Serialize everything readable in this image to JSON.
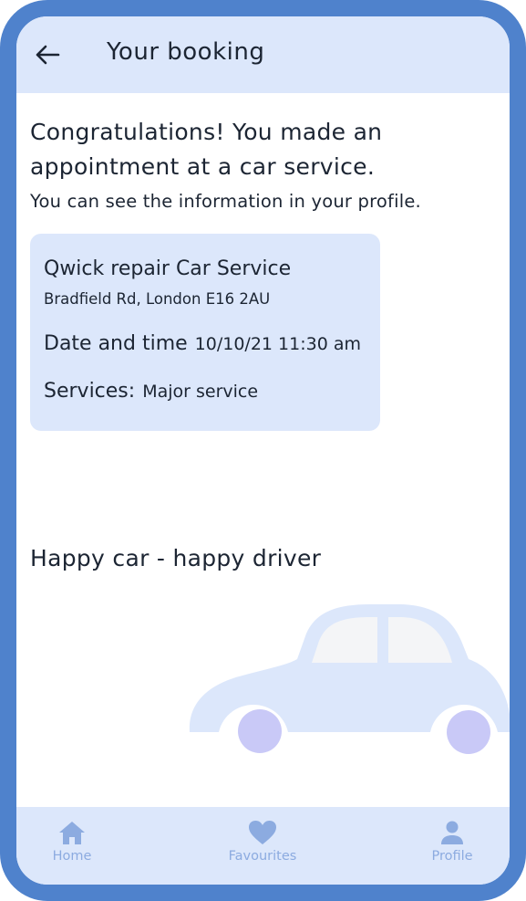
{
  "header": {
    "title": "Your booking",
    "back_icon": "arrow-left-icon"
  },
  "message": {
    "headline": "Congratulations! You made an appointment at a car service.",
    "subtext": "You can see the information in your profile."
  },
  "booking": {
    "service_name": "Qwick repair Car Service",
    "address": "Bradfield Rd, London E16 2AU",
    "datetime_label": "Date and time",
    "datetime_value": "10/10/21 11:30 am",
    "services_label": "Services:",
    "services_value": "Major service"
  },
  "tagline": "Happy car - happy driver",
  "illustration": {
    "name": "car-illustration",
    "body_color": "#dce7fb",
    "wheel_color": "#c9c9f7"
  },
  "nav": {
    "items": [
      {
        "label": "Home",
        "icon": "home-icon"
      },
      {
        "label": "Favourites",
        "icon": "heart-icon"
      },
      {
        "label": "Profile",
        "icon": "user-icon"
      }
    ]
  },
  "colors": {
    "frame": "#4f82cc",
    "panel": "#dce7fb",
    "text": "#1c2533",
    "nav_icon": "#8cabe0"
  }
}
